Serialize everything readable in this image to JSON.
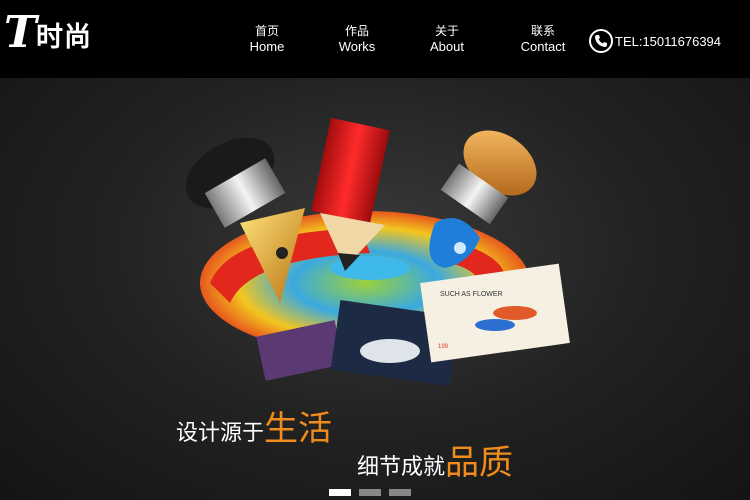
{
  "logo": {
    "letter": "T",
    "text": "时尚"
  },
  "nav": [
    {
      "cn": "首页",
      "en": "Home"
    },
    {
      "cn": "作品",
      "en": "Works"
    },
    {
      "cn": "关于",
      "en": "About"
    },
    {
      "cn": "联系",
      "en": "Contact"
    }
  ],
  "contact": {
    "tel": "TEL:15011676394",
    "icon": "phone-icon"
  },
  "banner": {
    "slogan_line1_white": "设计源于",
    "slogan_line1_orange": "生活",
    "slogan_line2_white": "细节成就",
    "slogan_line2_orange": "品质",
    "card_text": "SUCH AS FLOWER",
    "card_price": "199",
    "active_slide": 1,
    "slide_count": 3
  },
  "colors": {
    "header_bg": "#000000",
    "accent": "#f08c1c"
  }
}
